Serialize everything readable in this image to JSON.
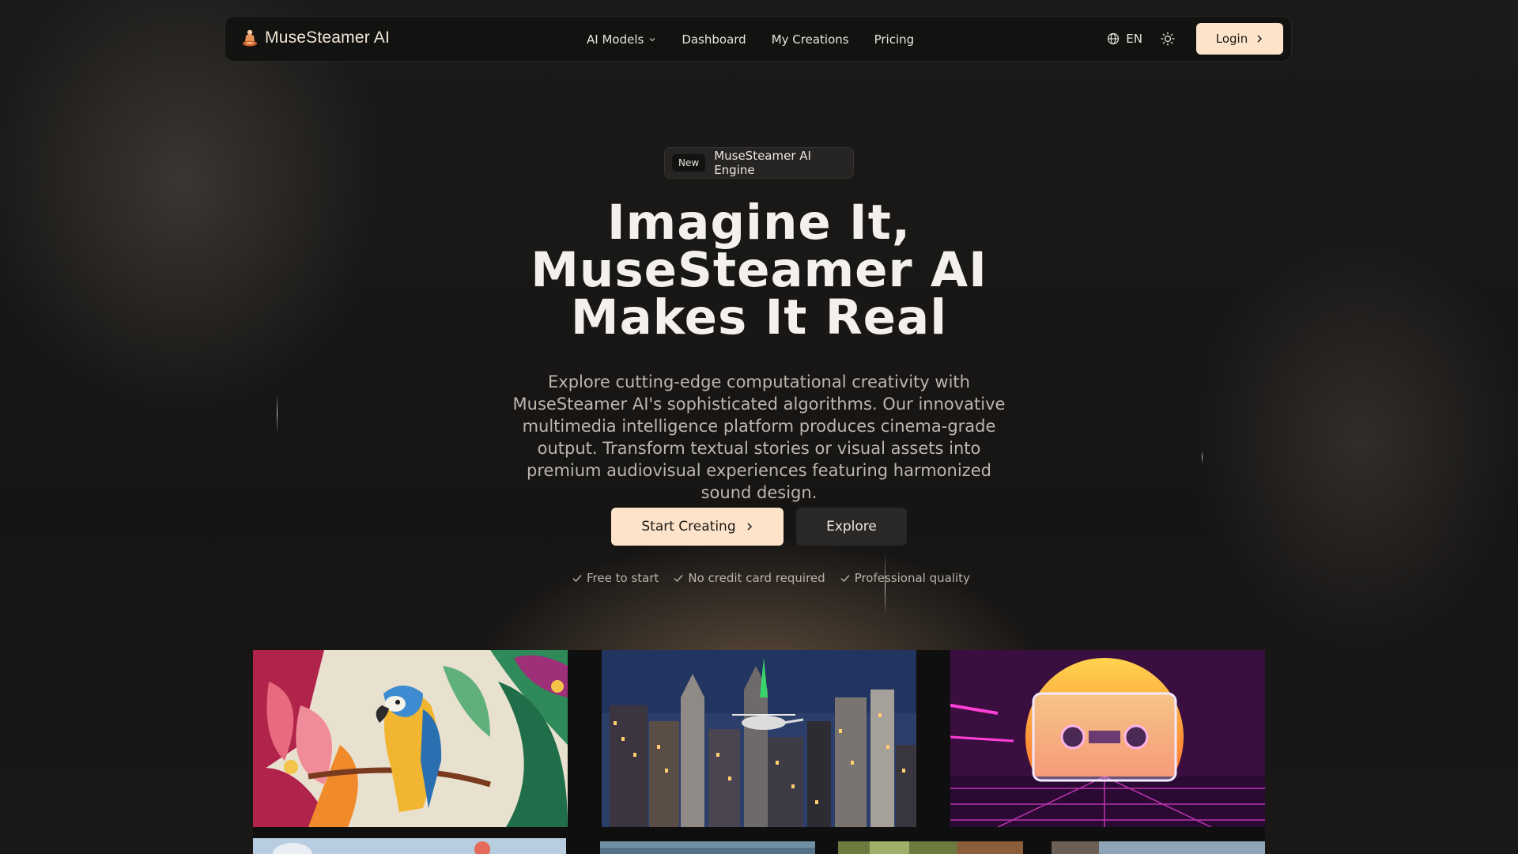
{
  "nav": {
    "brand_name": "MuseSteamer AI",
    "links": [
      {
        "label": "AI Models",
        "has_dropdown": true
      },
      {
        "label": "Dashboard"
      },
      {
        "label": "My Creations"
      },
      {
        "label": "Pricing"
      }
    ],
    "language": "EN",
    "login_label": "Login"
  },
  "hero": {
    "badge_tag": "New",
    "badge_text": "MuseSteamer AI Engine",
    "headline_lines": [
      "Imagine It,",
      "MuseSteamer AI",
      "Makes It Real"
    ],
    "subtitle": "Explore cutting-edge computational creativity with MuseSteamer AI's sophisticated algorithms. Our innovative multimedia intelligence platform produces cinema-grade output. Transform textual stories or visual assets into premium audiovisual experiences featuring harmonized sound design.",
    "primary_cta": "Start Creating",
    "secondary_cta": "Explore",
    "features": [
      "Free to start",
      "No credit card required",
      "Professional quality"
    ]
  },
  "gallery": {
    "tiles": [
      "parrot-illustration",
      "city-skyline-helicopter",
      "retro-cassette-sunset",
      "sky-scene",
      "lake-scene",
      "forest-scene",
      "mountain-scene"
    ]
  },
  "colors": {
    "accent": "#fde3c9",
    "background": "#171615",
    "nav_bg": "#121211"
  }
}
